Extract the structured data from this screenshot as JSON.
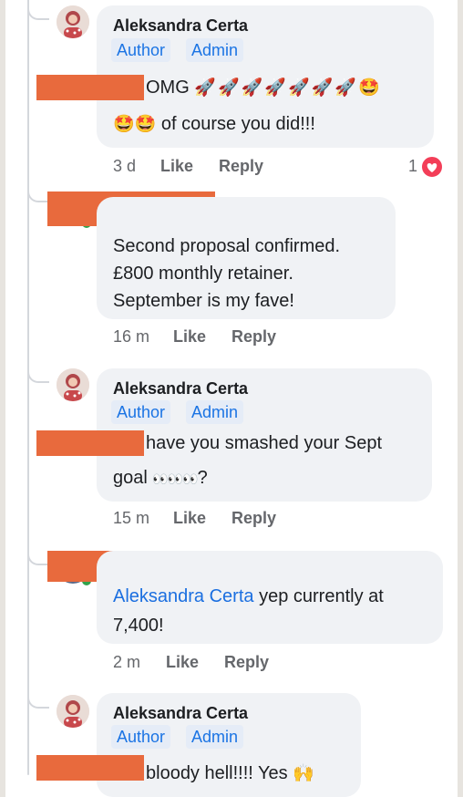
{
  "comments": [
    {
      "author": "Aleksandra Certa",
      "badges": [
        "Author",
        "Admin"
      ],
      "line1": "OMG",
      "line2": "of course you did!!!",
      "time": "3 d",
      "like": "Like",
      "reply": "Reply",
      "reaction_count": "1",
      "reaction_icon": "heart-icon"
    },
    {
      "line1": "Second proposal confirmed.",
      "line2": "£800 monthly retainer.",
      "line3": "September is my fave!",
      "time": "16 m",
      "like": "Like",
      "reply": "Reply"
    },
    {
      "author": "Aleksandra Certa",
      "badges": [
        "Author",
        "Admin"
      ],
      "line1": "have you smashed your Sept",
      "line2_a": "goal",
      "line2_b": "?",
      "time": "15 m",
      "like": "Like",
      "reply": "Reply"
    },
    {
      "mention": "Aleksandra Certa",
      "line1": " yep currently at",
      "line2": "7,400!",
      "time": "2 m",
      "like": "Like",
      "reply": "Reply"
    },
    {
      "author": "Aleksandra Certa",
      "badges": [
        "Author",
        "Admin"
      ],
      "line1": "bloody hell!!!! Yes"
    }
  ],
  "colors": {
    "redaction": "#e86a3d",
    "bubble": "#f0f2f5",
    "badge_text": "#1b74e4",
    "mention": "#1b6fe0"
  }
}
